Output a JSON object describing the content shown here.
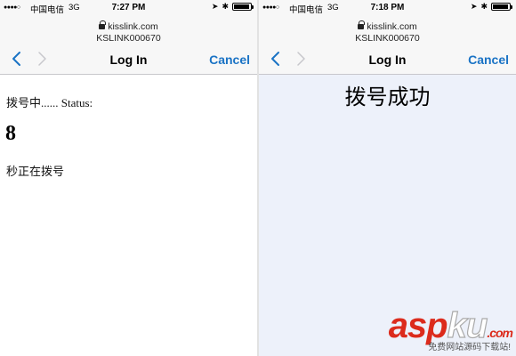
{
  "screens": [
    {
      "status_bar": {
        "signal": "●●●●○",
        "carrier": "中国电信",
        "network": "3G",
        "time": "7:27 PM",
        "battery_level": 0.95
      },
      "browser": {
        "domain": "kisslink.com",
        "cert": "KSLINK000670",
        "title": "Log In",
        "cancel_label": "Cancel"
      },
      "content": {
        "dial_line": "拨号中...... Status:",
        "count": "8",
        "dialing_text": "秒正在拨号"
      }
    },
    {
      "status_bar": {
        "signal": "●●●●○",
        "carrier": "中国电信",
        "network": "3G",
        "time": "7:18 PM",
        "battery_level": 0.95
      },
      "browser": {
        "domain": "kisslink.com",
        "cert": "KSLINK000670",
        "title": "Log In",
        "cancel_label": "Cancel"
      },
      "content": {
        "success_text": "拨号成功"
      }
    }
  ],
  "watermark": {
    "brand_main": "asp",
    "brand_accent": "ku",
    "brand_suffix": ".com",
    "tagline": "免费网站源码下载站!"
  },
  "colors": {
    "link_blue": "#1a73c5",
    "chevron_disabled": "#c7c7cc",
    "page_right_bg": "#edf1fa",
    "watermark_red": "#dc2b1c"
  },
  "icons": {
    "lock": "lock-icon",
    "back": "chevron-left-icon",
    "forward": "chevron-right-icon",
    "location": "location-arrow-icon",
    "bluetooth": "bluetooth-icon",
    "battery": "battery-icon"
  }
}
